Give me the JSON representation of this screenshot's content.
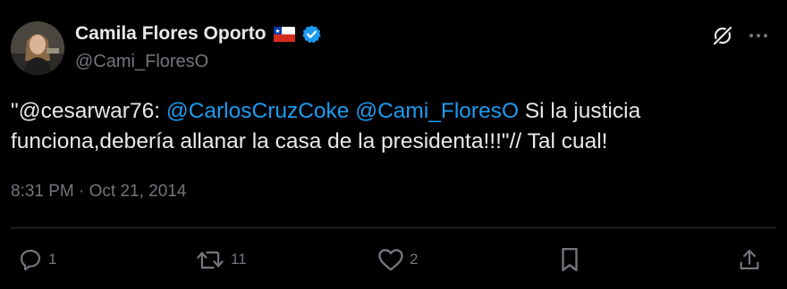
{
  "author": {
    "display_name": "Camila Flores Oporto",
    "handle": "@Cami_FloresO",
    "flag": "chile-flag-icon",
    "verified": "verified-badge-icon"
  },
  "tweet": {
    "quote_open": "\"@cesarwar76: ",
    "mention_1": "@CarlosCruzCoke",
    "space": " ",
    "mention_2": "@Cami_FloresO",
    "text_rest": " Si la justicia funciona,debería allanar la casa de la presidenta!!!\"// Tal cual!",
    "timestamp": "8:31 PM · Oct 21, 2014"
  },
  "actions": {
    "replies": "1",
    "retweets": "11",
    "likes": "2"
  },
  "colors": {
    "background": "#000000",
    "text": "#e7e9ea",
    "secondary": "#71767b",
    "accent": "#1d9bf0"
  }
}
